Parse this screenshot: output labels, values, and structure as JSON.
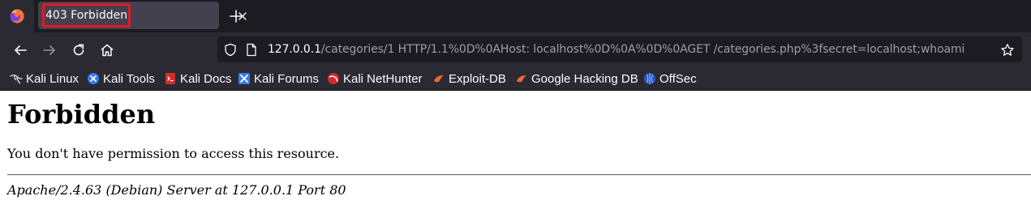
{
  "browser": {
    "tab": {
      "title": "403 Forbidden"
    },
    "urlbar": {
      "host": "127.0.0.1",
      "rest": "/categories/1 HTTP/1.1%0D%0AHost: localhost%0D%0A%0D%0AGET /categories.php%3fsecret=localhost;whoami"
    },
    "bookmarks": [
      {
        "label": "Kali Linux",
        "icon": "kali-dragon-icon"
      },
      {
        "label": "Kali Tools",
        "icon": "kali-tools-icon"
      },
      {
        "label": "Kali Docs",
        "icon": "kali-docs-icon"
      },
      {
        "label": "Kali Forums",
        "icon": "kali-forums-icon"
      },
      {
        "label": "Kali NetHunter",
        "icon": "kali-nethunter-icon"
      },
      {
        "label": "Exploit-DB",
        "icon": "exploit-db-icon"
      },
      {
        "label": "Google Hacking DB",
        "icon": "ghdb-icon"
      },
      {
        "label": "OffSec",
        "icon": "offsec-icon"
      }
    ]
  },
  "page": {
    "title": "Forbidden",
    "message": "You don't have permission to access this resource.",
    "footer": "Apache/2.4.63 (Debian) Server at 127.0.0.1 Port 80"
  },
  "colors": {
    "tab_highlight": "#e01b24",
    "toolbar_bg": "#2b2a33",
    "urlbar_bg": "#1c1b22"
  }
}
